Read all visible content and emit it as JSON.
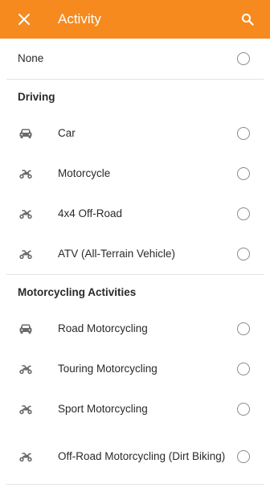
{
  "theme": {
    "accent": "#f68a1e",
    "icon_color": "#6b6b6b",
    "divider_color": "#e2e2e2"
  },
  "header": {
    "title": "Activity",
    "close_icon": "close-icon",
    "search_icon": "search-icon"
  },
  "none_option": {
    "label": "None",
    "selected": false
  },
  "sections": [
    {
      "title": "Driving",
      "items": [
        {
          "label": "Car",
          "icon": "car-icon",
          "selected": false
        },
        {
          "label": "Motorcycle",
          "icon": "motorcycle-icon",
          "selected": false
        },
        {
          "label": "4x4 Off-Road",
          "icon": "offroad-vehicle-icon",
          "selected": false
        },
        {
          "label": "ATV (All-Terrain Vehicle)",
          "icon": "atv-icon",
          "selected": false
        }
      ]
    },
    {
      "title": "Motorcycling Activities",
      "items": [
        {
          "label": "Road Motorcycling",
          "icon": "car-icon",
          "selected": false
        },
        {
          "label": "Touring Motorcycling",
          "icon": "motorcycle-icon",
          "selected": false
        },
        {
          "label": "Sport Motorcycling",
          "icon": "motorcycle-icon",
          "selected": false
        },
        {
          "label": "Off-Road Motorcycling (Dirt Biking)",
          "icon": "motorcycle-icon",
          "selected": false
        }
      ]
    }
  ]
}
